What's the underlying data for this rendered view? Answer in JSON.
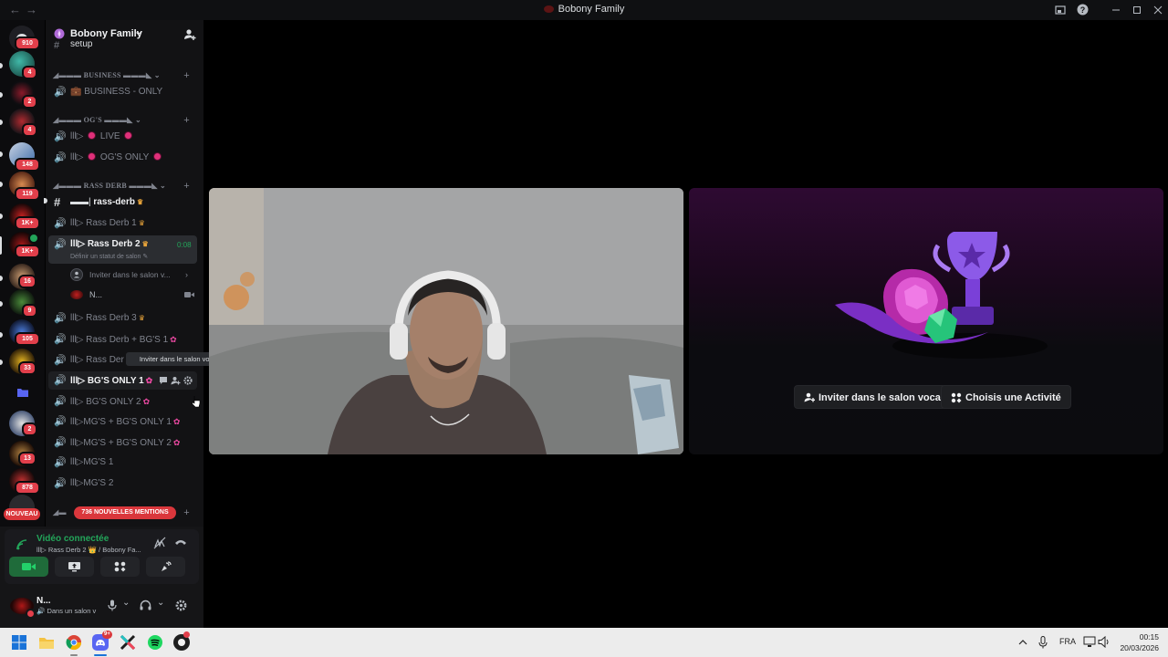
{
  "window": {
    "title": "Bobony Family",
    "back": "←",
    "forward": "→"
  },
  "rail": {
    "badges": [
      "910",
      "4",
      "2",
      "4",
      "148",
      "119",
      "1K+",
      "1K+",
      "16",
      "9",
      "105",
      "33",
      "2",
      "13",
      "878"
    ],
    "new_label": "NOUVEAU"
  },
  "guild": {
    "name": "Bobony Family",
    "chevron": "⌄",
    "partial_channel": "setup"
  },
  "categories": {
    "business": "◢▬▬▬ BUSINESS ▬▬▬◣",
    "ogs": "◢▬▬▬ OG'S ▬▬▬◣",
    "rass_derb": "◢▬▬▬ RASS DERB ▬▬▬◣"
  },
  "channels": {
    "business_only": "BUSINESS - ONLY",
    "live": "LIVE",
    "ogs_only": "OG'S ONLY",
    "rass_derb_text": "rass-derb",
    "rass_derb_1": "Rass Derb 1",
    "rass_derb_2": "Rass Derb 2",
    "rass_derb_2_time": "0:08",
    "rass_derb_2_status": "Définir un statut de salon",
    "invite_row": "Inviter dans le salon v...",
    "member_name": "N...",
    "rass_derb_3": "Rass Derb 3",
    "rass_derb_bg1": "Rass Derb + BG'S 1",
    "rass_derb_bg2": "Rass Der",
    "tooltip": "Inviter dans le salon vocal",
    "bgs_only_1": "BG'S ONLY 1",
    "bgs_only_2": "BG'S ONLY 2",
    "mgs_bgs_1": "MG'S + BG'S ONLY 1",
    "mgs_bgs_2": "MG'S + BG'S ONLY 2",
    "mgs_1": "MG'S 1",
    "mgs_2": "MG'S 2",
    "prefix": "lll▷",
    "mentions_pill": "736 NOUVELLES MENTIONS"
  },
  "voice_panel": {
    "status": "Vidéo connectée",
    "location": "lll▷ Rass Derb 2 👑 / Bobony Fa..."
  },
  "user_panel": {
    "name": "N...",
    "status": "Dans un salon v"
  },
  "stage": {
    "invite_button": "Inviter dans le salon vocal",
    "activity_button": "Choisis une Activité"
  },
  "taskbar": {
    "discord_badge": "9+",
    "language": "FRA",
    "time": "00:15",
    "date": "20/03/2026"
  },
  "colors": {
    "accent_green": "#23a55a",
    "mention_red": "#da373c",
    "brand_purple": "#a855f7"
  }
}
